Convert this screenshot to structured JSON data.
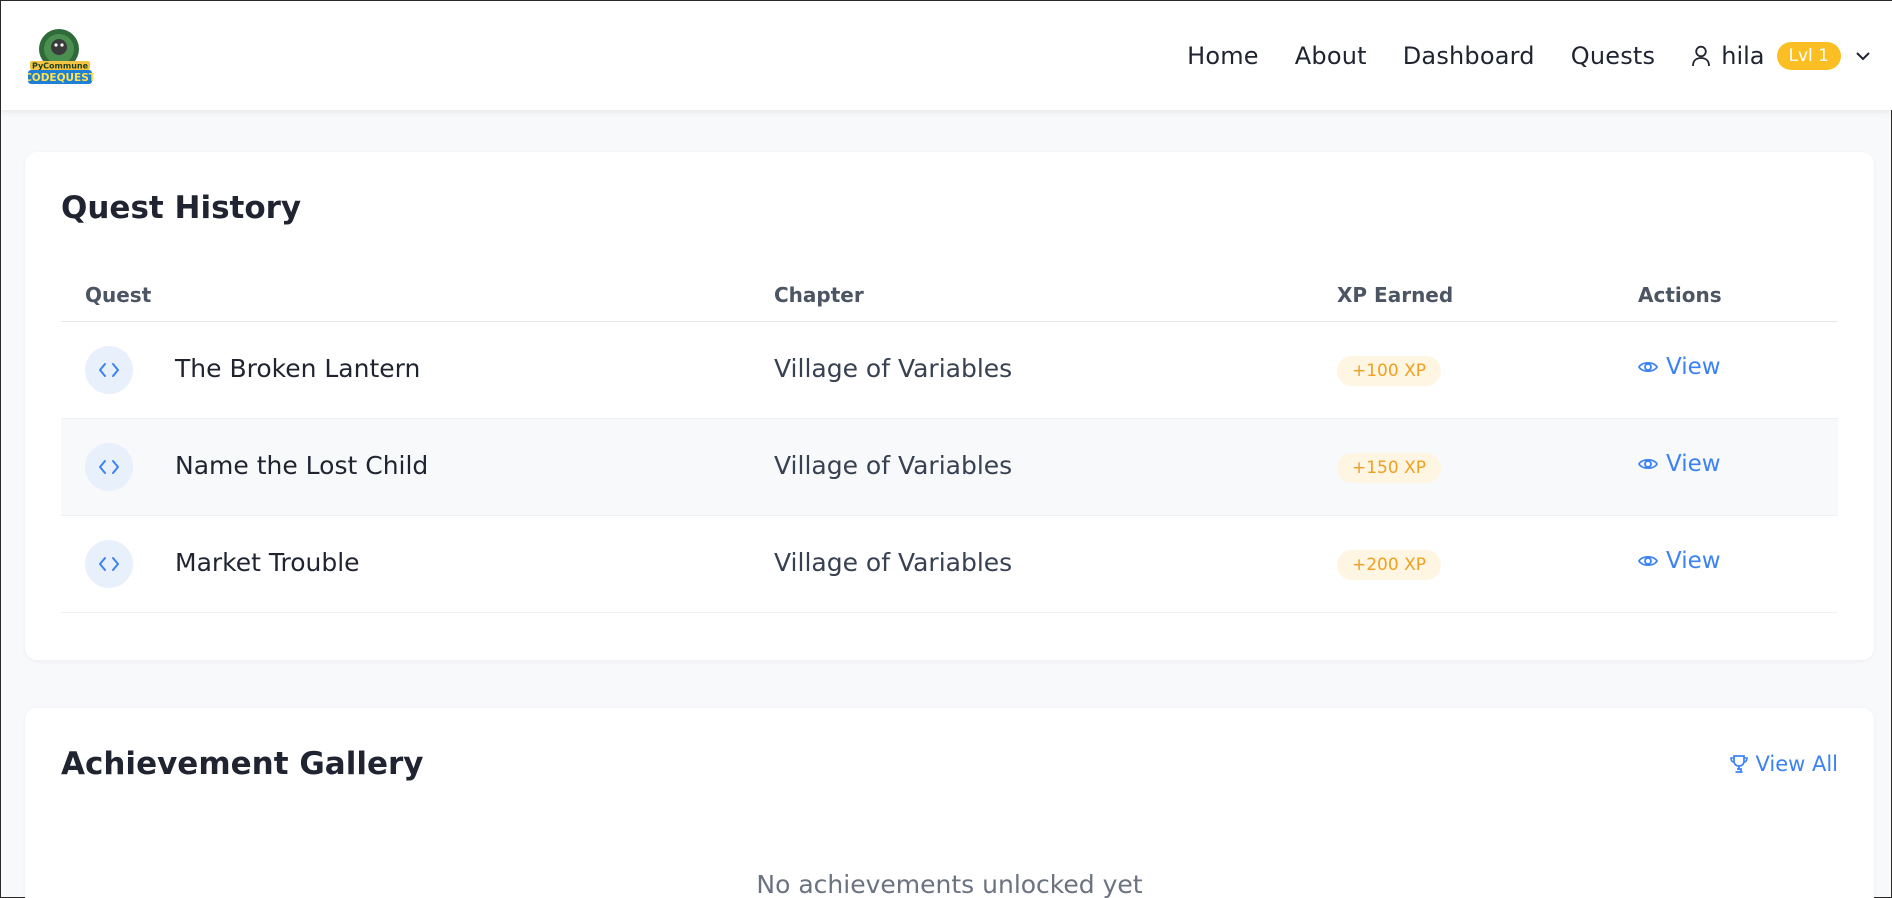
{
  "brand": {
    "logo_top_text": "PyCommune",
    "logo_bottom_text": "CODEQUEST"
  },
  "nav": {
    "links": [
      "Home",
      "About",
      "Dashboard",
      "Quests"
    ],
    "user": {
      "name": "hila",
      "level": "Lvl 1"
    }
  },
  "quest_history": {
    "title": "Quest History",
    "columns": [
      "Quest",
      "Chapter",
      "XP Earned",
      "Actions"
    ],
    "rows": [
      {
        "quest": "The Broken Lantern",
        "chapter": "Village of Variables",
        "xp": "+100 XP",
        "action": "View"
      },
      {
        "quest": "Name the Lost Child",
        "chapter": "Village of Variables",
        "xp": "+150 XP",
        "action": "View"
      },
      {
        "quest": "Market Trouble",
        "chapter": "Village of Variables",
        "xp": "+200 XP",
        "action": "View"
      }
    ]
  },
  "achievements": {
    "title": "Achievement Gallery",
    "view_all": "View All",
    "empty_message": "No achievements unlocked yet"
  },
  "colors": {
    "accent_blue": "#3b82f6",
    "level_badge": "#fbbf24",
    "xp_text": "#f0a020",
    "xp_bg": "#fef5e2"
  },
  "icons": {
    "logo": "bear-badge-logo",
    "user": "user-icon",
    "dropdown": "chevron-down-icon",
    "quest": "code-icon",
    "view": "eye-icon",
    "view_all": "trophy-icon"
  }
}
